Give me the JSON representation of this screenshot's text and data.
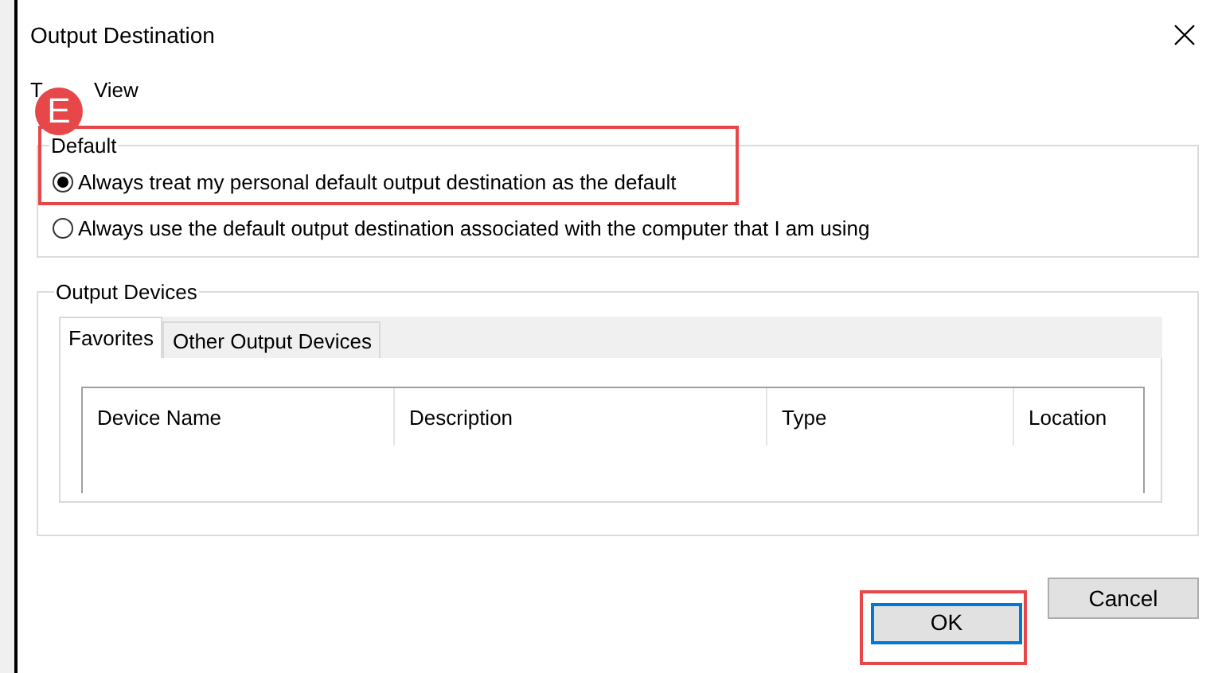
{
  "window": {
    "title": "Output Destination"
  },
  "menu": [
    {
      "label": "T"
    },
    {
      "label": "View"
    }
  ],
  "default_group": {
    "title": "Default",
    "options": [
      {
        "label": "Always treat my personal default output destination as the default",
        "selected": true
      },
      {
        "label": "Always use the default output destination associated with the computer that I am using",
        "selected": false
      }
    ]
  },
  "output_devices": {
    "title": "Output Devices",
    "tabs": [
      {
        "label": "Favorites",
        "selected": true
      },
      {
        "label": "Other Output Devices",
        "selected": false
      }
    ],
    "columns": [
      "Device Name",
      "Description",
      "Type",
      "Location"
    ]
  },
  "buttons": [
    {
      "label": "OK",
      "default": true
    },
    {
      "label": "Cancel",
      "default": false
    }
  ],
  "annotation": {
    "badge": "E"
  }
}
